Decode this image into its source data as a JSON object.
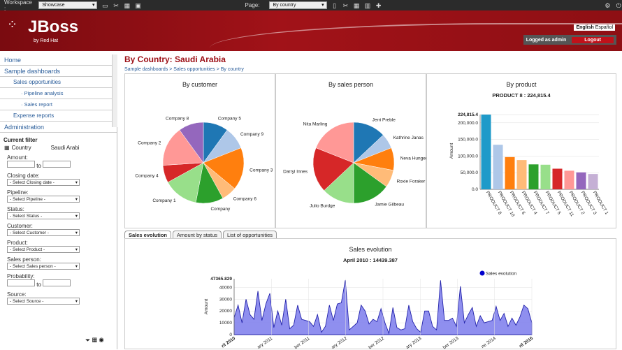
{
  "topbar": {
    "workspace_label": "Workspace :",
    "workspace_value": "Showcase",
    "page_label": "Page:",
    "page_value": "By country"
  },
  "header": {
    "logo_text": "JBoss",
    "logo_sub": "by Red Hat",
    "lang_english": "English",
    "lang_spanish": "Español",
    "logged_as": "Logged as admin",
    "logout": "Logout"
  },
  "sidebar": {
    "nav": [
      "Home",
      "Sample dashboards",
      "Sales opportunities",
      "· Pipeline analysis",
      "· Sales report",
      "Expense reports",
      "Administration"
    ],
    "filter_title": "Current filter",
    "country_label": "Country",
    "country_value": "Saudi Arabi",
    "amount_label": "Amount:",
    "to": "to",
    "closing_label": "Closing date:",
    "closing_ddl": "- Select Closing date -",
    "pipeline_label": "Pipeline:",
    "pipeline_ddl": "- Select Pipeline -",
    "status_label": "Status:",
    "status_ddl": "- Select Status -",
    "customer_label": "Customer:",
    "customer_ddl": "- Select Customer -",
    "product_label": "Product:",
    "product_ddl": "- Select Product -",
    "salesperson_label": "Sales person:",
    "salesperson_ddl": "- Select Sales person -",
    "probability_label": "Probability:",
    "source_label": "Source:",
    "source_ddl": "- Select Source -"
  },
  "main": {
    "title": "By Country: Saudi Arabia",
    "breadcrumb": "Sample dashboards > Sales opportunities > By country",
    "tabs": [
      "Sales evolution",
      "Amount by status",
      "List of opportunities"
    ]
  },
  "chart_data": [
    {
      "type": "pie",
      "title": "By customer",
      "categories": [
        "Company 5",
        "Company 9",
        "Company 3",
        "Company 6",
        "Company",
        "Company 1",
        "Company 4",
        "Company 2",
        "Company 8"
      ],
      "values": [
        10,
        9,
        17,
        6,
        11,
        14,
        7,
        16,
        10
      ],
      "colors": [
        "#1f77b4",
        "#aec7e8",
        "#ff7f0e",
        "#ffbb78",
        "#2ca02c",
        "#98df8a",
        "#d62728",
        "#ff9896",
        "#9467bd"
      ]
    },
    {
      "type": "pie",
      "title": "By sales person",
      "categories": [
        "Jerri Preble",
        "Kathrine Janas",
        "Neva Hunger",
        "Roxie Foraker",
        "Jamie Gilbeau",
        "Julio Burdge",
        "Darryl Innes",
        "Nita Marling"
      ],
      "values": [
        13,
        6,
        9,
        7,
        15,
        13,
        18,
        19
      ],
      "colors": [
        "#1f77b4",
        "#aec7e8",
        "#ff7f0e",
        "#ffbb78",
        "#2ca02c",
        "#98df8a",
        "#d62728",
        "#ff9896"
      ]
    },
    {
      "type": "bar",
      "title": "By product",
      "subtitle": "PRODUCT 8 : 224,815.4",
      "ylabel": "Amount",
      "ylim": [
        0,
        224815.4
      ],
      "yticks": [
        "224,815.4",
        "200,000.0",
        "150,000.0",
        "100,000.0",
        "50,000.0",
        "0.0"
      ],
      "categories": [
        "PRODUCT 8",
        "PRODUCT 10",
        "PRODUCT 6",
        "PRODUCT 4",
        "PRODUCT 7",
        "PRODUCT 5",
        "PRODUCT 11",
        "PRODUCT 2",
        "PRODUCT 3",
        "PRODUCT 1"
      ],
      "values": [
        224815.4,
        134000,
        97000,
        88000,
        75000,
        74000,
        62000,
        56000,
        51000,
        46000
      ],
      "colors": [
        "#1f9ac9",
        "#aec7e8",
        "#ff7f0e",
        "#ffbb78",
        "#2ca02c",
        "#98df8a",
        "#d62728",
        "#ff9896",
        "#9467bd",
        "#c5b0d5"
      ]
    },
    {
      "type": "area",
      "title": "Sales evolution",
      "subtitle": "April 2010 : 14439.387",
      "ylabel": "Amount",
      "legend": "Sales evolution",
      "legend_position": "top-right",
      "ytop_label": "47365.829",
      "yticks": [
        40000,
        30000,
        20000,
        10000,
        0
      ],
      "ylim": [
        0,
        47365.829
      ],
      "xlabels": [
        "ril 2010",
        "ary 2011",
        "ber 2011",
        "ary 2012",
        "ber 2012",
        "ary 2013",
        "ber 2013",
        "ne 2014",
        "ril 2015"
      ],
      "values": [
        14439,
        25000,
        10000,
        30000,
        17000,
        13000,
        37000,
        12000,
        26000,
        35000,
        6000,
        20000,
        8000,
        30000,
        5000,
        8000,
        25000,
        13000,
        12000,
        11000,
        7000,
        17000,
        2000,
        7000,
        25000,
        12000,
        26000,
        27000,
        46000,
        4000,
        7000,
        10000,
        25000,
        20000,
        9000,
        13000,
        11000,
        22000,
        10000,
        1000,
        23000,
        6000,
        4000,
        5000,
        25000,
        11000,
        5000,
        2000,
        20000,
        20000,
        7000,
        4000,
        46000,
        12000,
        12000,
        14000,
        7000,
        41000,
        10000,
        17000,
        23000,
        7000,
        16000,
        10000,
        11000,
        12000,
        24000,
        12000,
        18000,
        7000,
        14000,
        8000,
        15000,
        25000,
        22000,
        10000
      ],
      "color": "#7b7bec"
    }
  ]
}
